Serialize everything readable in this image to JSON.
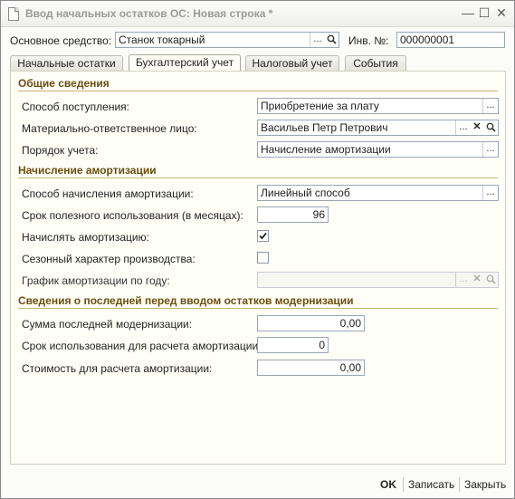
{
  "window": {
    "title": "Ввод начальных остатков ОС: Новая строка *",
    "minimize_glyph": "—",
    "maximize_glyph": "☐",
    "close_glyph": "✕"
  },
  "header": {
    "asset_label": "Основное средство:",
    "asset_value": "Станок токарный",
    "inv_label": "Инв. №:",
    "inv_value": "000000001"
  },
  "tabs": [
    {
      "label": "Начальные остатки",
      "active": false
    },
    {
      "label": "Бухгалтерский учет",
      "active": true
    },
    {
      "label": "Налоговый учет",
      "active": false
    },
    {
      "label": "События",
      "active": false
    }
  ],
  "general": {
    "title": "Общие сведения",
    "receipt_method_label": "Способ поступления:",
    "receipt_method_value": "Приобретение за плату",
    "responsible_label": "Материально-ответственное лицо:",
    "responsible_value": "Васильев Петр Петрович",
    "accounting_order_label": "Порядок учета:",
    "accounting_order_value": "Начисление амортизации"
  },
  "depreciation": {
    "title": "Начисление амортизации",
    "method_label": "Способ начисления амортизации:",
    "method_value": "Линейный способ",
    "useful_life_label": "Срок полезного использования (в месяцах):",
    "useful_life_value": "96",
    "accrue_label": "Начислять амортизацию:",
    "accrue_checked": true,
    "seasonal_label": "Сезонный характер производства:",
    "seasonal_checked": false,
    "schedule_label": "График амортизации по году:",
    "schedule_value": ""
  },
  "modernization": {
    "title": "Сведения о последней перед вводом остатков модернизации",
    "sum_label": "Сумма последней модернизации:",
    "sum_value": "0,00",
    "term_label": "Срок использования для расчета амортизации:",
    "term_value": "0",
    "cost_label": "Стоимость для расчета амортизации:",
    "cost_value": "0,00"
  },
  "footer": {
    "ok_label": "OK",
    "save_label": "Записать",
    "close_label": "Закрыть"
  }
}
